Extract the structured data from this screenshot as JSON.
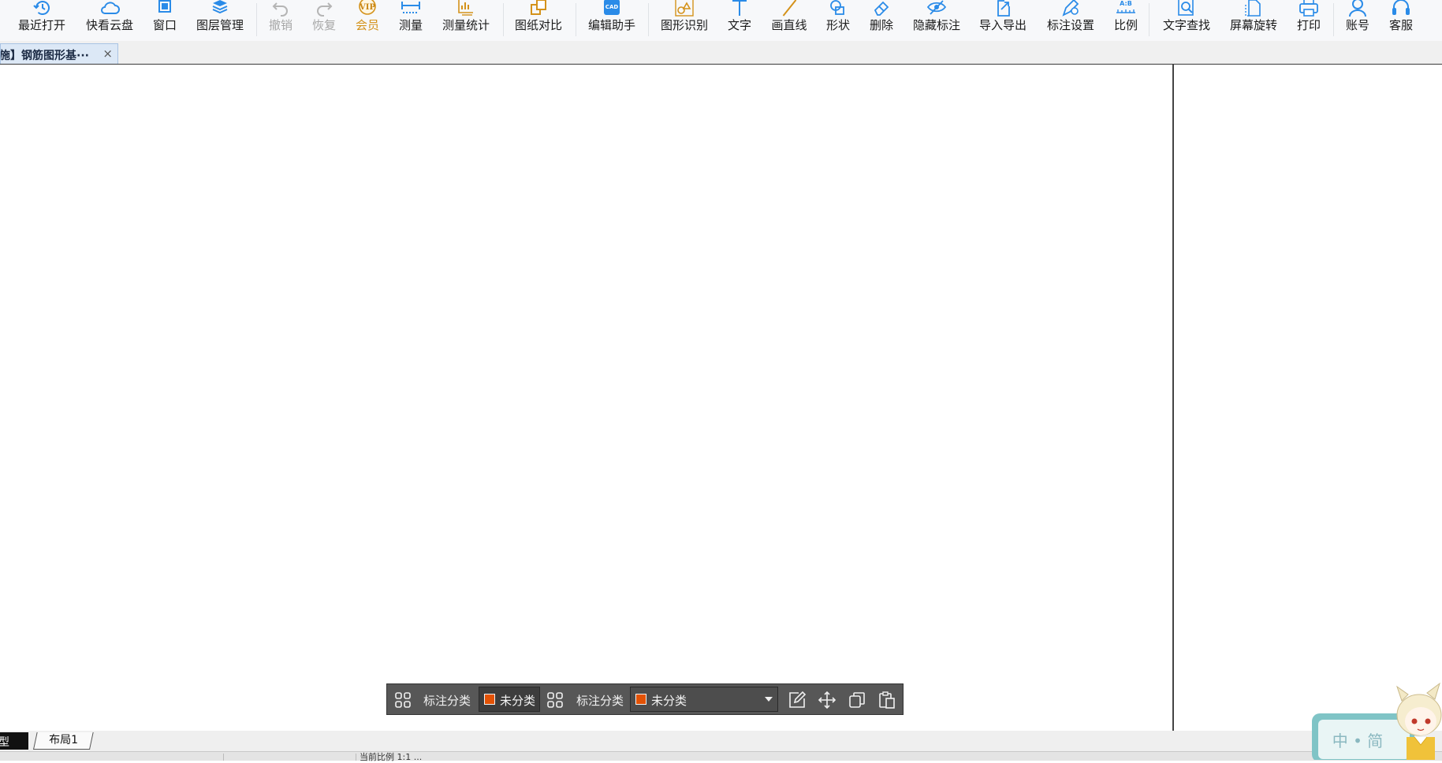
{
  "toolbar": {
    "items": [
      {
        "label": "最近打开",
        "icon": "history-icon"
      },
      {
        "label": "快看云盘",
        "icon": "cloud-icon"
      },
      {
        "label": "窗口",
        "icon": "window-icon"
      },
      {
        "label": "图层管理",
        "icon": "layers-icon"
      },
      {
        "label": "撤销",
        "icon": "undo-icon",
        "disabled": true
      },
      {
        "label": "恢复",
        "icon": "redo-icon",
        "disabled": true
      },
      {
        "label": "会员",
        "icon": "vip-icon",
        "badge": "VIP"
      },
      {
        "label": "测量",
        "icon": "ruler-icon"
      },
      {
        "label": "测量统计",
        "icon": "measure-stats-icon"
      },
      {
        "label": "图纸对比",
        "icon": "compare-icon"
      },
      {
        "label": "编辑助手",
        "icon": "cad-edit-icon",
        "badge": "CAD"
      },
      {
        "label": "图形识别",
        "icon": "shape-recognize-icon"
      },
      {
        "label": "文字",
        "icon": "text-icon"
      },
      {
        "label": "画直线",
        "icon": "line-icon"
      },
      {
        "label": "形状",
        "icon": "shape-icon"
      },
      {
        "label": "删除",
        "icon": "eraser-icon"
      },
      {
        "label": "隐藏标注",
        "icon": "hide-annotation-icon"
      },
      {
        "label": "导入导出",
        "icon": "import-export-icon"
      },
      {
        "label": "标注设置",
        "icon": "annotation-settings-icon"
      },
      {
        "label": "比例",
        "icon": "scale-icon",
        "badge": "A:B"
      },
      {
        "label": "文字查找",
        "icon": "text-search-icon"
      },
      {
        "label": "屏幕旋转",
        "icon": "rotate-screen-icon"
      },
      {
        "label": "打印",
        "icon": "print-icon"
      },
      {
        "label": "账号",
        "icon": "account-icon"
      },
      {
        "label": "客服",
        "icon": "headset-icon"
      }
    ]
  },
  "document_tab": {
    "title": "施】钢筋图形基···",
    "close_glyph": "×"
  },
  "annotation_bar": {
    "category_label_1": "标注分类",
    "category_value_1": "未分类",
    "category_label_2": "标注分类",
    "category_value_2": "未分类",
    "swatch_color": "#e35205"
  },
  "layout_tabs": {
    "model": "型",
    "layout1": "布局1"
  },
  "status": {
    "text": "当前比例 1:1 ..."
  },
  "mascot": {
    "text": "中 • 简"
  },
  "colors": {
    "accent": "#2a8be8",
    "vip": "#d4921a",
    "disabled": "#a7a7a7"
  }
}
